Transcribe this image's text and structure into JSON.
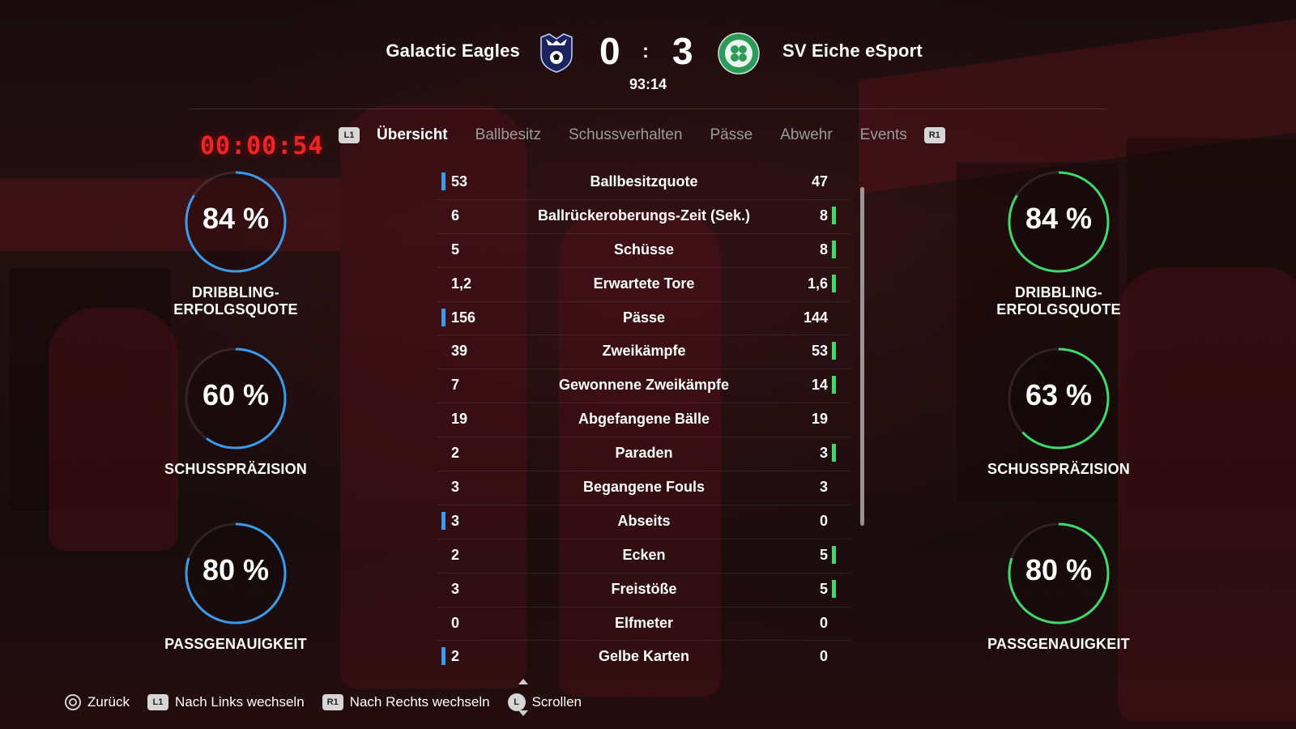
{
  "match": {
    "home_team": "Galactic Eagles",
    "away_team": "SV Eiche eSport",
    "home_score": "0",
    "away_score": "3",
    "separator": ":",
    "clock": "93:14"
  },
  "tabs": {
    "left_button": "L1",
    "right_button": "R1",
    "items": [
      "Übersicht",
      "Ballbesitz",
      "Schussverhalten",
      "Pässe",
      "Abwehr",
      "Events"
    ],
    "active": "Übersicht"
  },
  "background_timer": "00:00:54",
  "gauges": {
    "home": [
      {
        "value": "84 %",
        "label": "DRIBBLING-ERFOLGSQUOTE",
        "fraction": 0.84
      },
      {
        "value": "60 %",
        "label": "SCHUSSPRÄZISION",
        "fraction": 0.6
      },
      {
        "value": "80 %",
        "label": "PASSGENAUIGKEIT",
        "fraction": 0.8
      }
    ],
    "away": [
      {
        "value": "84 %",
        "label": "DRIBBLING-ERFOLGSQUOTE",
        "fraction": 0.84
      },
      {
        "value": "63 %",
        "label": "SCHUSSPRÄZISION",
        "fraction": 0.63
      },
      {
        "value": "80 %",
        "label": "PASSGENAUIGKEIT",
        "fraction": 0.8
      }
    ]
  },
  "stats": [
    {
      "home": "53",
      "label": "Ballbesitzquote",
      "away": "47",
      "leader": "home"
    },
    {
      "home": "6",
      "label": "Ballrückeroberungs-Zeit (Sek.)",
      "away": "8",
      "leader": "away"
    },
    {
      "home": "5",
      "label": "Schüsse",
      "away": "8",
      "leader": "away"
    },
    {
      "home": "1,2",
      "label": "Erwartete Tore",
      "away": "1,6",
      "leader": "away"
    },
    {
      "home": "156",
      "label": "Pässe",
      "away": "144",
      "leader": "home"
    },
    {
      "home": "39",
      "label": "Zweikämpfe",
      "away": "53",
      "leader": "away"
    },
    {
      "home": "7",
      "label": "Gewonnene Zweikämpfe",
      "away": "14",
      "leader": "away"
    },
    {
      "home": "19",
      "label": "Abgefangene Bälle",
      "away": "19",
      "leader": "none"
    },
    {
      "home": "2",
      "label": "Paraden",
      "away": "3",
      "leader": "away"
    },
    {
      "home": "3",
      "label": "Begangene Fouls",
      "away": "3",
      "leader": "none"
    },
    {
      "home": "3",
      "label": "Abseits",
      "away": "0",
      "leader": "home"
    },
    {
      "home": "2",
      "label": "Ecken",
      "away": "5",
      "leader": "away"
    },
    {
      "home": "3",
      "label": "Freistöße",
      "away": "5",
      "leader": "away"
    },
    {
      "home": "0",
      "label": "Elfmeter",
      "away": "0",
      "leader": "none"
    },
    {
      "home": "2",
      "label": "Gelbe Karten",
      "away": "0",
      "leader": "home"
    }
  ],
  "footer": {
    "back_label": "Zurück",
    "left_button": "L1",
    "left_label": "Nach Links wechseln",
    "right_button": "R1",
    "right_label": "Nach Rechts wechseln",
    "stick_button": "L",
    "scroll_label": "Scrollen"
  },
  "colors": {
    "home_accent": "#3b9bea",
    "away_accent": "#3fd86a",
    "timer_red": "#ff2a2a"
  },
  "icons": {
    "home_crest": "eagle-crest-icon",
    "away_crest": "clover-crest-icon",
    "back": "circle-button-icon",
    "scroll": "left-stick-icon"
  }
}
